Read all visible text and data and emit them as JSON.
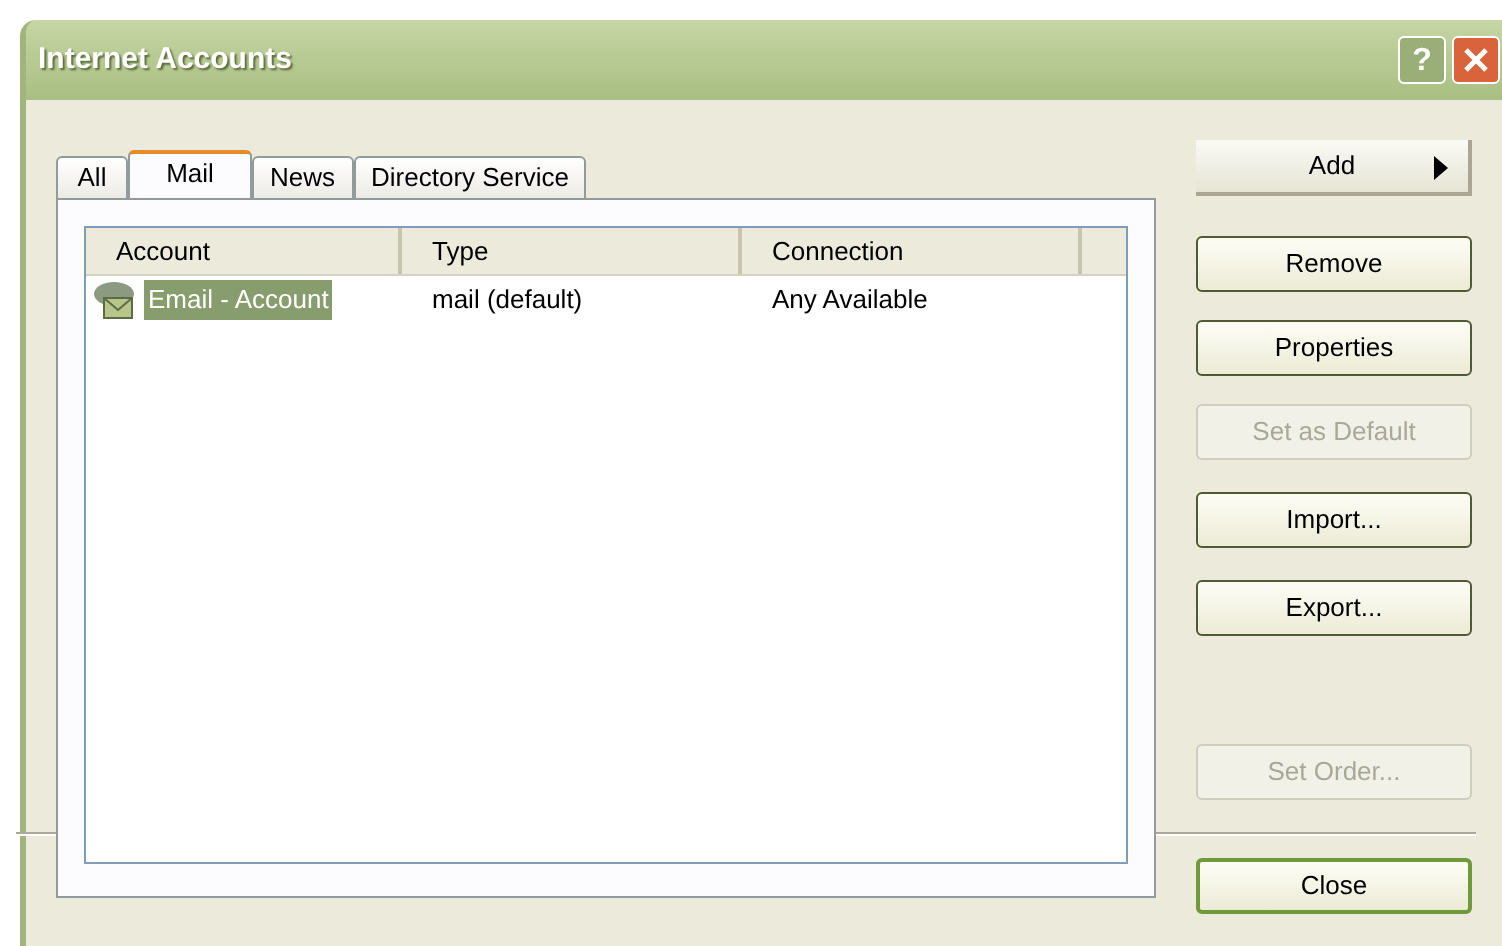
{
  "window": {
    "title": "Internet Accounts",
    "help_button": "?"
  },
  "tabs": [
    {
      "label": "All",
      "selected": false
    },
    {
      "label": "Mail",
      "selected": true
    },
    {
      "label": "News",
      "selected": false
    },
    {
      "label": "Directory Service",
      "selected": false
    }
  ],
  "table": {
    "columns": [
      "Account",
      "Type",
      "Connection"
    ],
    "rows": [
      {
        "account": "Email - Account",
        "type": "mail (default)",
        "connection": "Any Available",
        "selected": true
      }
    ]
  },
  "buttons": [
    {
      "label": "Add",
      "kind": "menu",
      "disabled": false
    },
    {
      "label": "Remove",
      "kind": "push",
      "disabled": false
    },
    {
      "label": "Properties",
      "kind": "push",
      "disabled": false
    },
    {
      "label": "Set as Default",
      "kind": "push",
      "disabled": true
    },
    {
      "label": "Import...",
      "kind": "push",
      "disabled": false
    },
    {
      "label": "Export...",
      "kind": "push",
      "disabled": false
    },
    {
      "label": "Set Order...",
      "kind": "push",
      "disabled": true
    }
  ],
  "footer_button": {
    "label": "Close"
  }
}
